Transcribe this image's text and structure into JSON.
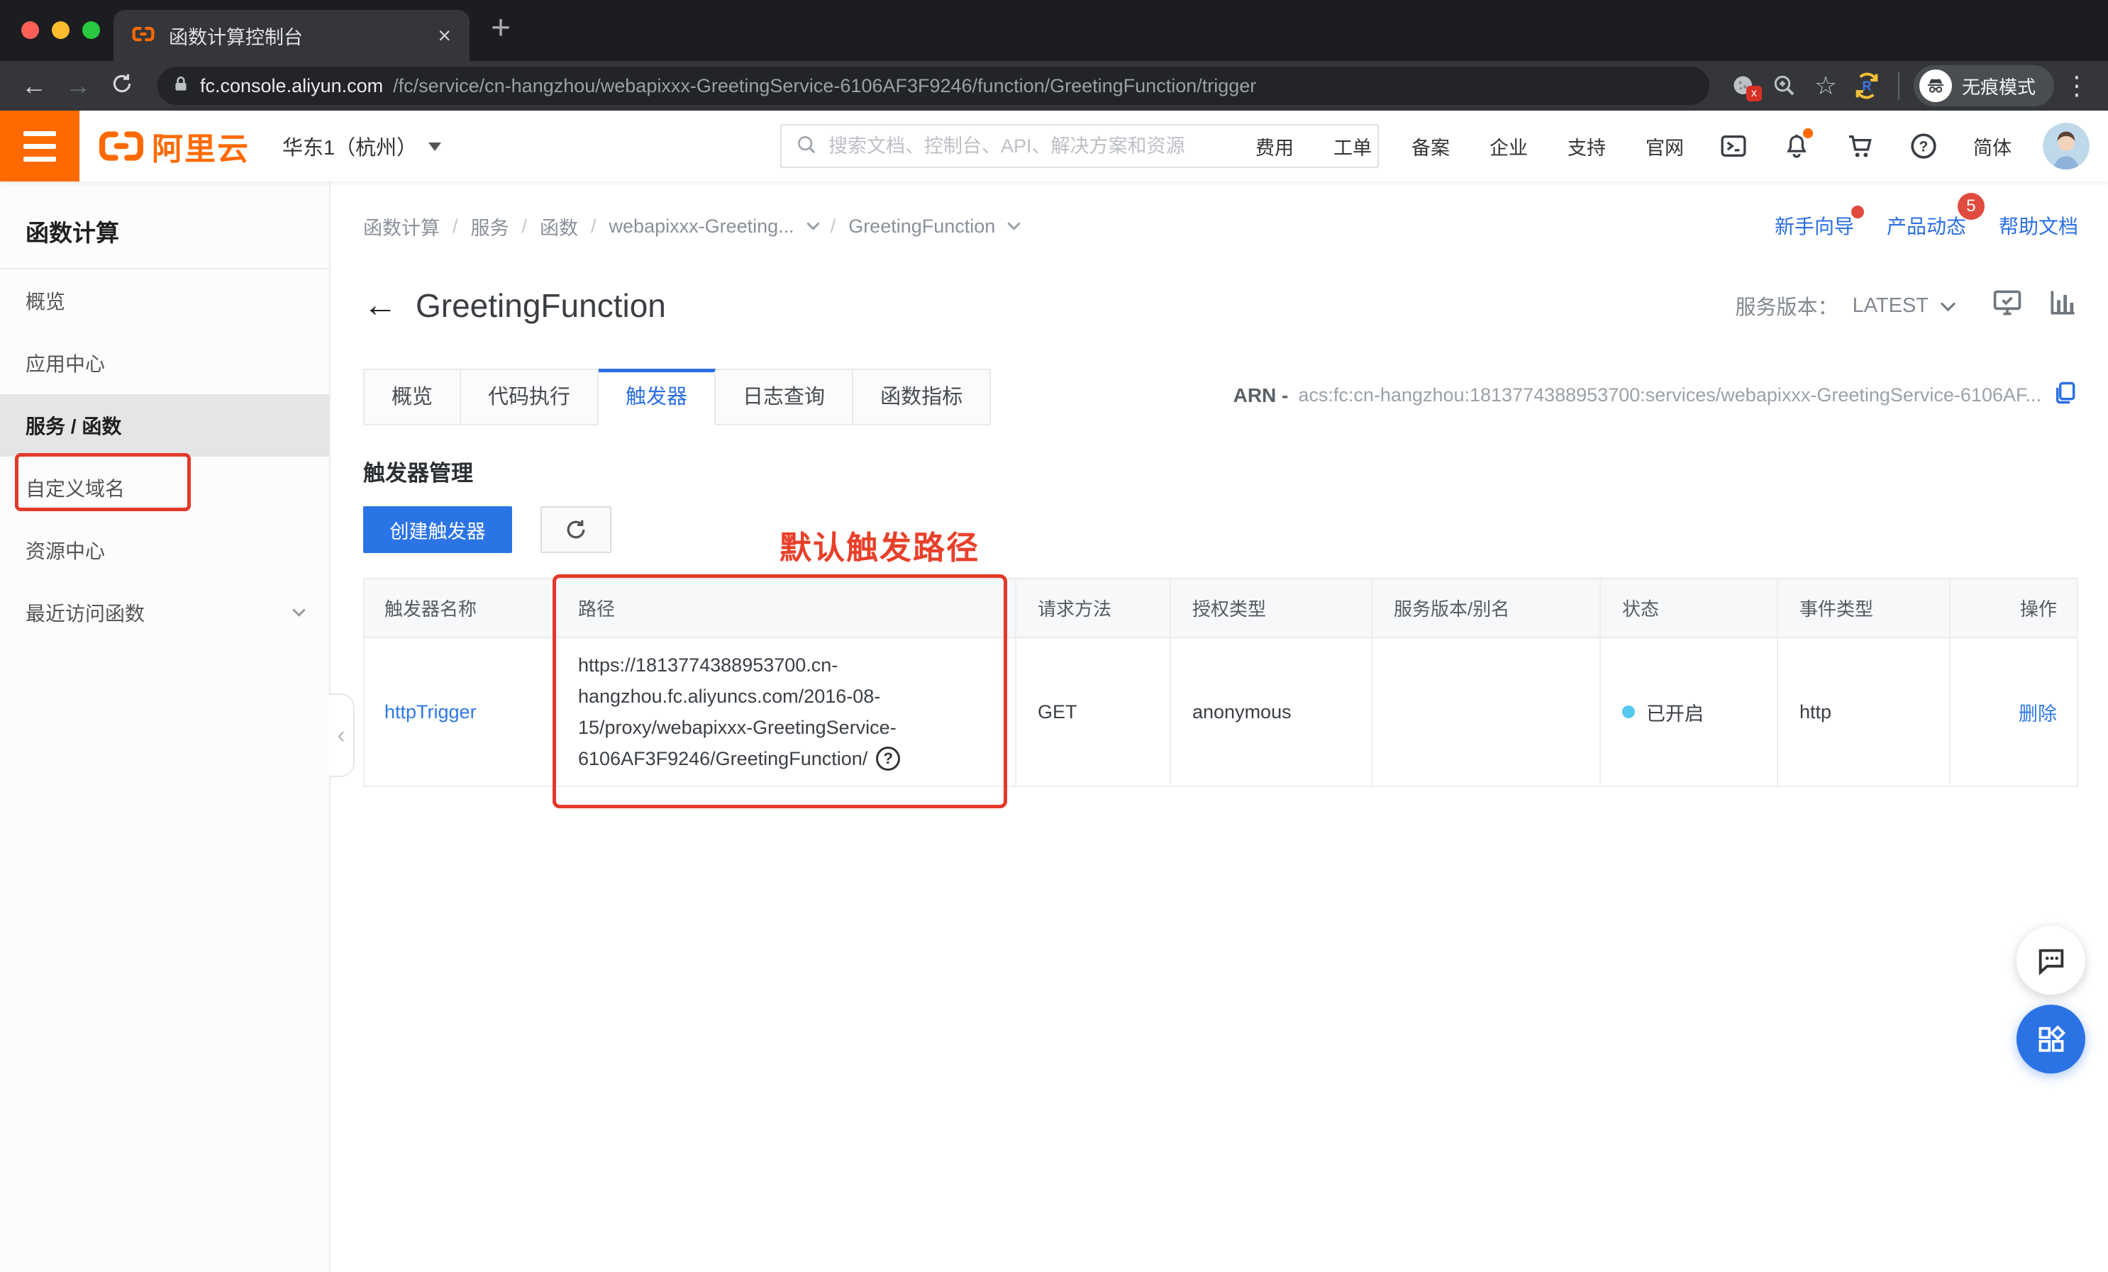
{
  "browser": {
    "tab_title": "函数计算控制台",
    "url_host": "fc.console.aliyun.com",
    "url_path": "/fc/service/cn-hangzhou/webapixxx-GreetingService-6106AF3F9246/function/GreetingFunction/trigger",
    "incognito_label": "无痕模式"
  },
  "glyphs": {
    "close": "×",
    "new_tab": "+",
    "back": "←",
    "forward": "→",
    "more": "⋮",
    "collapse": "‹",
    "star": "☆",
    "slash": "/",
    "question": "?",
    "badge_x": "x"
  },
  "topnav": {
    "brand": "阿里云",
    "region": "华东1（杭州）",
    "search_placeholder": "搜索文档、控制台、API、解决方案和资源",
    "links": [
      "费用",
      "工单",
      "备案",
      "企业",
      "支持",
      "官网"
    ],
    "lang": "简体"
  },
  "sidebar": {
    "title": "函数计算",
    "items": [
      {
        "label": "概览"
      },
      {
        "label": "应用中心"
      },
      {
        "label": "服务 / 函数"
      },
      {
        "label": "自定义域名"
      },
      {
        "label": "资源中心"
      },
      {
        "label": "最近访问函数"
      }
    ]
  },
  "breadcrumb": {
    "crumbs": [
      "函数计算",
      "服务",
      "函数",
      "webapixxx-Greeting...",
      "GreetingFunction"
    ]
  },
  "helper_links": {
    "guide": "新手向导",
    "news": "产品动态",
    "news_badge": "5",
    "docs": "帮助文档"
  },
  "page": {
    "title": "GreetingFunction",
    "version_label": "服务版本：",
    "version_value": "LATEST"
  },
  "tabs": {
    "items": [
      "概览",
      "代码执行",
      "触发器",
      "日志查询",
      "函数指标"
    ],
    "active": "触发器"
  },
  "arn": {
    "label": "ARN -",
    "value": "acs:fc:cn-hangzhou:1813774388953700:services/webapixxx-GreetingService-6106AF..."
  },
  "trigger_section": {
    "title": "触发器管理",
    "create_button": "创建触发器",
    "annotation": "默认触发路径"
  },
  "table": {
    "headers": [
      "触发器名称",
      "路径",
      "请求方法",
      "授权类型",
      "服务版本/别名",
      "状态",
      "事件类型",
      "操作"
    ],
    "row": {
      "name": "httpTrigger",
      "path_line1": "https://1813774388953700.cn-",
      "path_line2": "hangzhou.fc.aliyuncs.com/2016-08-",
      "path_line3": "15/proxy/webapixxx-GreetingService-",
      "path_line4": "6106AF3F9246/GreetingFunction/",
      "method": "GET",
      "auth": "anonymous",
      "version_alias": "",
      "status": "已开启",
      "event_type": "http",
      "action": "删除"
    }
  },
  "colors": {
    "aliyun_orange": "#ff6a00",
    "accent_blue": "#2b6fe3",
    "annotation_red": "#e23a2a",
    "status_cyan": "#54c8ee"
  }
}
